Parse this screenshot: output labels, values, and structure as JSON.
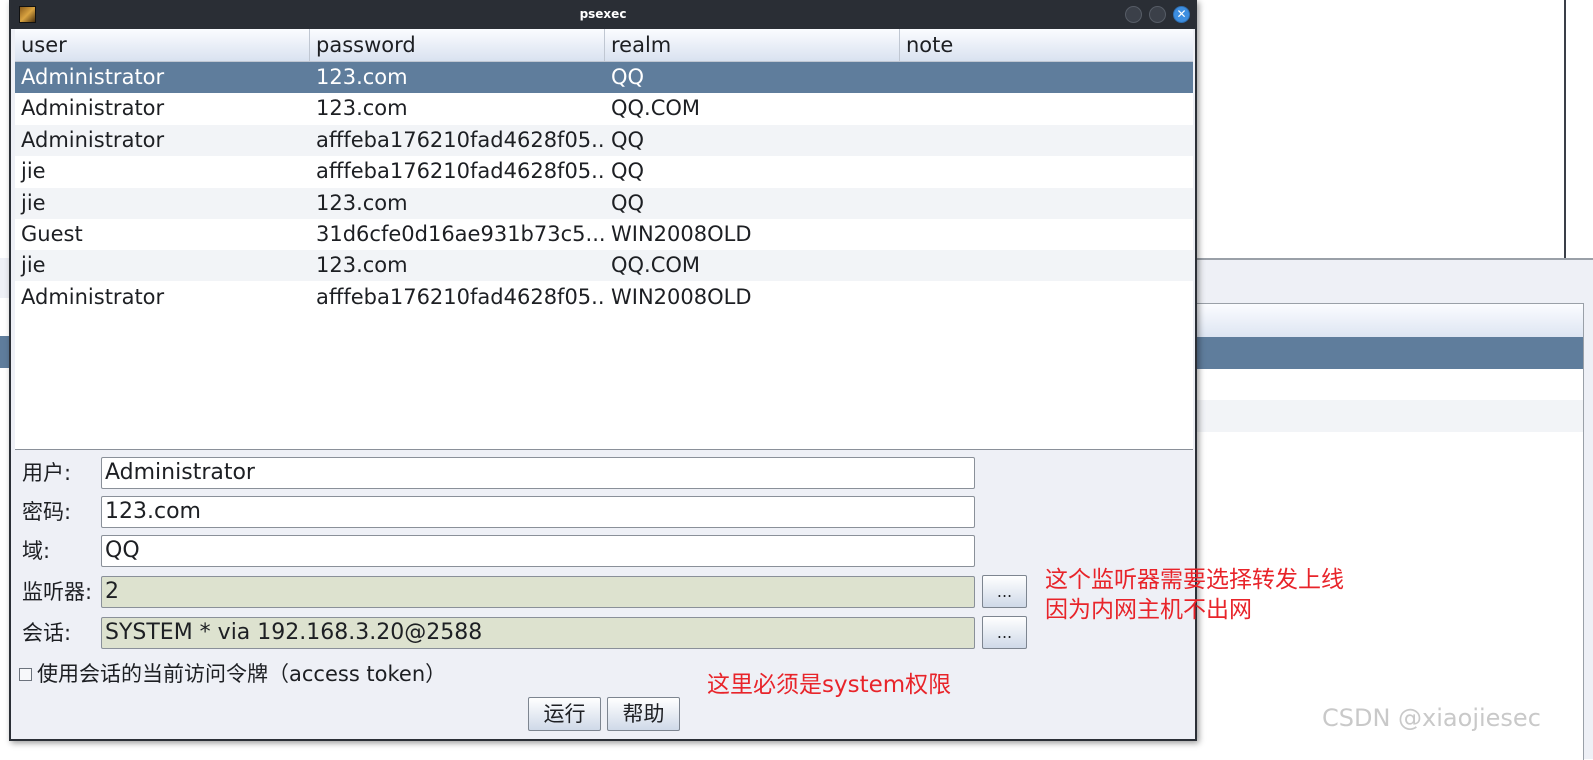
{
  "window": {
    "title": "psexec"
  },
  "table": {
    "columns": [
      "user",
      "password",
      "realm",
      "note"
    ],
    "rows": [
      [
        "Administrator",
        "123.com",
        "QQ",
        ""
      ],
      [
        "Administrator",
        "123.com",
        "QQ.COM",
        ""
      ],
      [
        "Administrator",
        "afffeba176210fad4628f05...",
        "QQ",
        ""
      ],
      [
        "jie",
        "afffeba176210fad4628f05...",
        "QQ",
        ""
      ],
      [
        "jie",
        "123.com",
        "QQ",
        ""
      ],
      [
        "Guest",
        "31d6cfe0d16ae931b73c5...",
        "WIN2008OLD",
        ""
      ],
      [
        "jie",
        "123.com",
        "QQ.COM",
        ""
      ],
      [
        "Administrator",
        "afffeba176210fad4628f05...",
        "WIN2008OLD",
        ""
      ]
    ],
    "selected_row": 0
  },
  "form": {
    "user_label": "用户:",
    "user_value": "Administrator",
    "password_label": "密码:",
    "password_value": "123.com",
    "domain_label": "域:",
    "domain_value": "QQ",
    "listener_label": "监听器:",
    "listener_value": "2",
    "session_label": "会话:",
    "session_value": "SYSTEM * via  192.168.3.20@2588",
    "browse_label": "...",
    "token_checkbox_label": "使用会话的当前访问令牌（access token）",
    "token_checked": false,
    "run_label": "运行",
    "help_label": "帮助"
  },
  "annotations": {
    "listener_note_line1": "这个监听器需要选择转发上线",
    "listener_note_line2": "因为内网主机不出网",
    "session_note": "这里必须是system权限"
  },
  "watermark": "CSDN @xiaojiesec",
  "colors": {
    "selection": "#5f7d9c",
    "annotation": "#e8242a",
    "titlebar": "#2a2e35"
  }
}
